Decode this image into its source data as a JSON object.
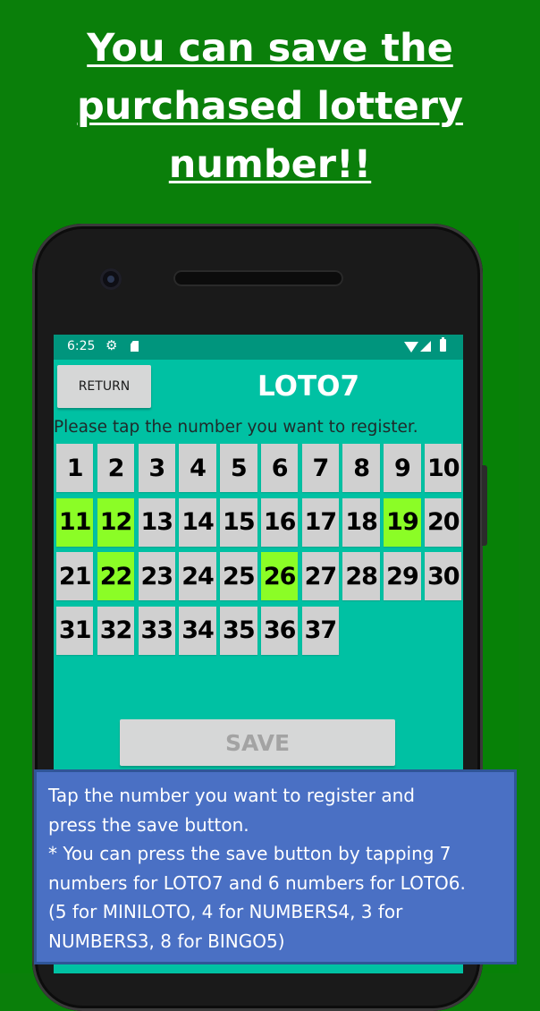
{
  "headline": {
    "lines": [
      "You can save the",
      "purchased lottery",
      "number!!"
    ]
  },
  "statusbar": {
    "time": "6:25",
    "icons": [
      "gear-icon",
      "sd-card-icon",
      "wifi-icon",
      "signal-icon",
      "battery-icon"
    ]
  },
  "app": {
    "return_label": "RETURN",
    "title": "LOTO7",
    "instruction": "Please tap the number you want to register.",
    "numbers": [
      1,
      2,
      3,
      4,
      5,
      6,
      7,
      8,
      9,
      10,
      11,
      12,
      13,
      14,
      15,
      16,
      17,
      18,
      19,
      20,
      21,
      22,
      23,
      24,
      25,
      26,
      27,
      28,
      29,
      30,
      31,
      32,
      33,
      34,
      35,
      36,
      37
    ],
    "selected_numbers": [
      11,
      12,
      19,
      22,
      26
    ],
    "save_label": "SAVE",
    "save_enabled": false
  },
  "colors": {
    "background": "#0a7f0a",
    "screen": "#00c1a3",
    "statusbar": "#00957d",
    "selected": "#8bfd26",
    "unselected": "#d0d0d0",
    "info_box": "#4a70c4"
  },
  "info": {
    "lines": [
      "Tap the number you want to register and",
      "press the save button.",
      "* You can press the save button by tapping 7",
      "numbers for LOTO7 and 6 numbers for LOTO6.",
      "(5 for MINILOTO, 4 for NUMBERS4, 3 for",
      "NUMBERS3, 8 for BINGO5)"
    ]
  }
}
